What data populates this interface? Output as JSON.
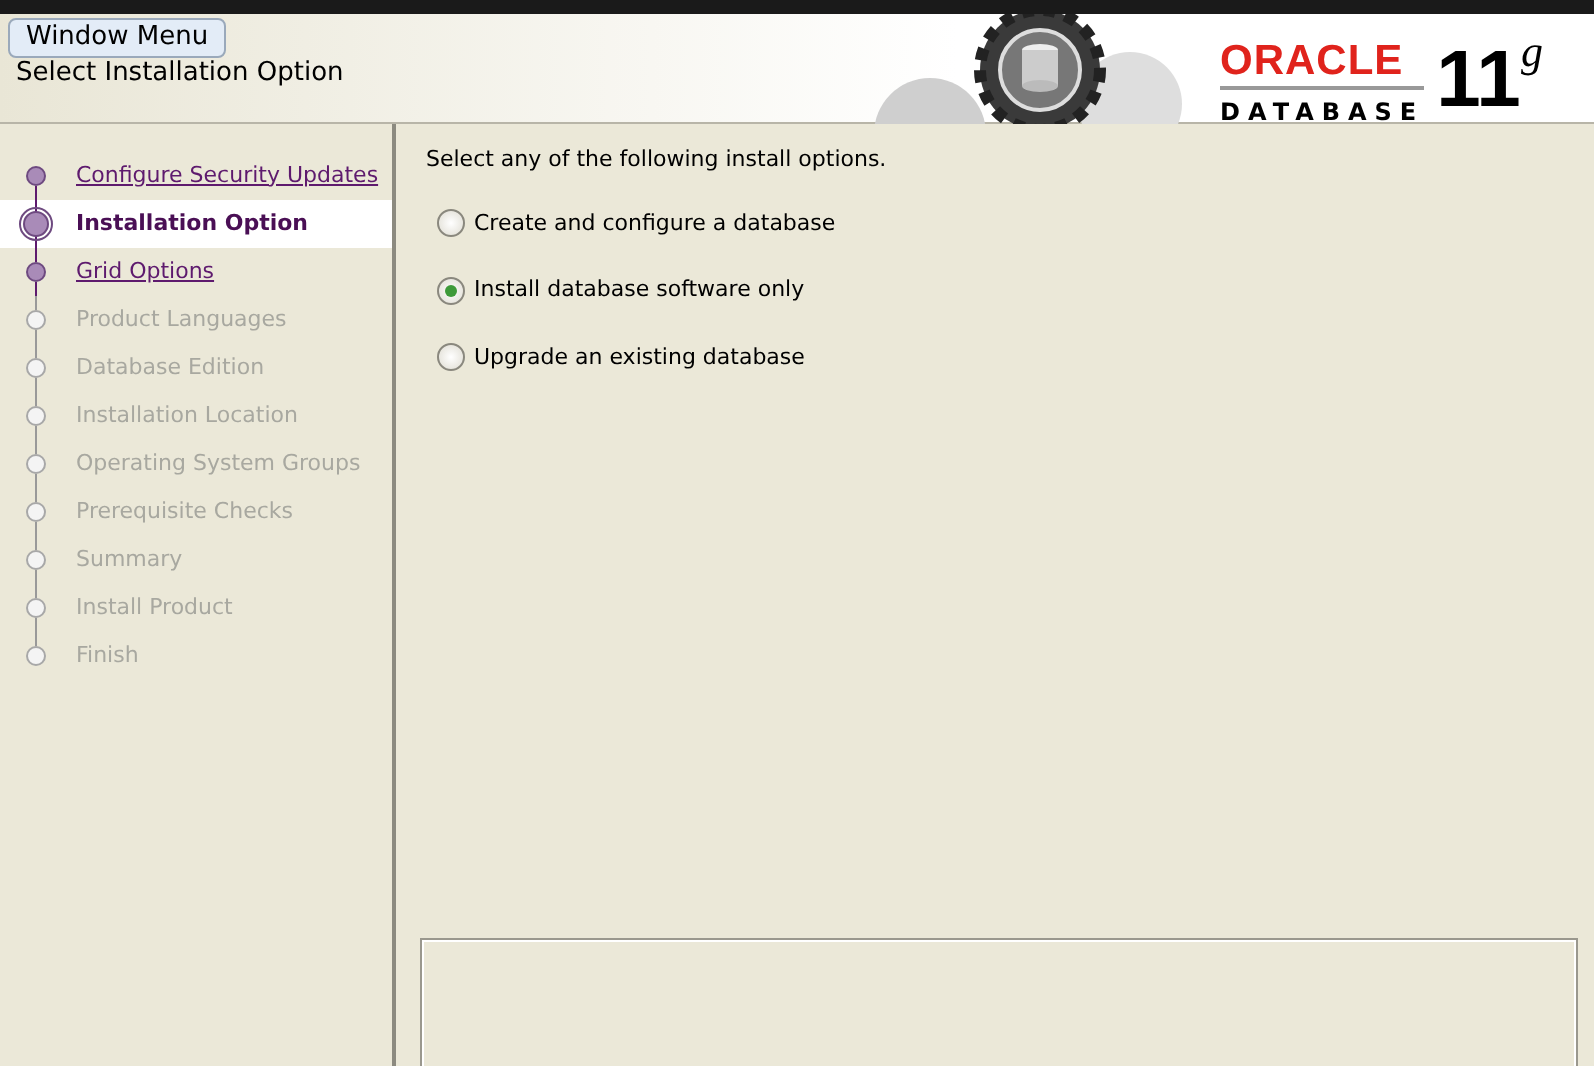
{
  "tooltip": "Window Menu",
  "header": {
    "title": "Select Installation Option",
    "logo": {
      "brand": "ORACLE",
      "product": "DATABASE",
      "version": "11$^{g}$"
    }
  },
  "steps": [
    {
      "label": "Configure Security Updates",
      "visited": true,
      "selected": false
    },
    {
      "label": "Installation Option",
      "visited": true,
      "selected": true
    },
    {
      "label": "Grid Options",
      "visited": true,
      "selected": false
    },
    {
      "label": "Product Languages",
      "visited": false,
      "selected": false
    },
    {
      "label": "Database Edition",
      "visited": false,
      "selected": false
    },
    {
      "label": "Installation Location",
      "visited": false,
      "selected": false
    },
    {
      "label": "Operating System Groups",
      "visited": false,
      "selected": false
    },
    {
      "label": "Prerequisite Checks",
      "visited": false,
      "selected": false
    },
    {
      "label": "Summary",
      "visited": false,
      "selected": false
    },
    {
      "label": "Install Product",
      "visited": false,
      "selected": false
    },
    {
      "label": "Finish",
      "visited": false,
      "selected": false
    }
  ],
  "content": {
    "prompt": "Select any of the following install options.",
    "options": [
      {
        "label": "Create and configure a database",
        "selected": false
      },
      {
        "label": "Install database software only",
        "selected": true
      },
      {
        "label": "Upgrade an existing database",
        "selected": false
      }
    ]
  }
}
